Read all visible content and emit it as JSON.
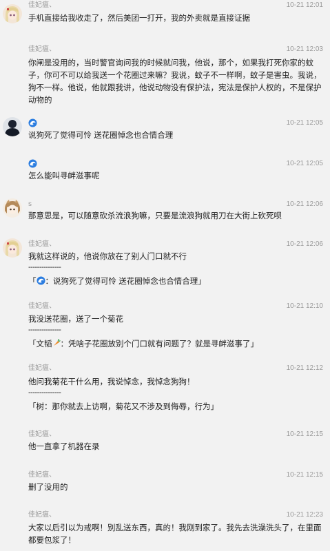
{
  "messages": [
    {
      "sender": "佳妃瘟、",
      "time": "10-21 12:01",
      "text": "手机直接给我收走了，然后美团一打开，我的外卖就是直接证据"
    },
    {
      "sender": "佳妃瘟、",
      "time": "10-21 12:03",
      "text": "你闸是没用的，当时警官询问我的时候就问我，他说，那个，如果我打死你家的蚊子，你可不可以给我送一个花圈过来嘛？我说，蚊子不一样啊，蚊子是害虫。我说，狗不一样。他说，他就跟我讲，他说动物没有保护法，宪法是保护人权的，不是保护动物的"
    },
    {
      "sender": "",
      "time": "10-21 12:05",
      "text": "说狗死了觉得可怜 送花圈悼念也合情合理"
    },
    {
      "sender": "",
      "time": "10-21 12:05",
      "text": "怎么能叫寻衅滋事呢"
    },
    {
      "sender": "s",
      "time": "10-21 12:06",
      "text": "那意思是，可以随意砍杀流浪狗嘛，只要是流浪狗就用刀在大街上砍死呗"
    },
    {
      "sender": "佳妃瘟、",
      "time": "10-21 12:06",
      "text": "我就这样说的，他说你放在了别人门口就不行",
      "separator": "---------------",
      "quote_prefix": "「",
      "quote_text": "：说狗死了觉得可怜 送花圈悼念也合情合理」"
    },
    {
      "sender": "佳妃瘟、",
      "time": "10-21 12:10",
      "text": "我没送花圈，送了一个菊花",
      "separator": "---------------",
      "quote_prefix": "「文韬",
      "quote_text": "：凭啥子花圈放别个门口就有问题了？就是寻衅滋事了」"
    },
    {
      "sender": "佳妃瘟、",
      "time": "10-21 12:12",
      "text": "他问我菊花干什么用，我说悼念，我悼念狗狗！",
      "separator": "---------------",
      "quote_prefix": "「树",
      "quote_text": "：那你就去上访啊，菊花又不涉及到侮辱，行为」"
    },
    {
      "sender": "佳妃瘟、",
      "time": "10-21 12:15",
      "text": "他一直拿了机器在录"
    },
    {
      "sender": "佳妃瘟、",
      "time": "10-21 12:15",
      "text": "删了没用的"
    },
    {
      "sender": "佳妃瘟、",
      "time": "10-21 12:23",
      "text": "大家以后引以为戒啊！别乱送东西，真的！我刚到家了。我先去洗澡洗头了，在里面都要包浆了！"
    }
  ],
  "icons": {
    "user_a_avatar": "anime-blonde-avatar",
    "user_b_avatar": "dark-figure-avatar",
    "user_c_avatar": "anime-brown-hair-avatar",
    "wave_badge": "wave-icon",
    "carrot": "carrot-icon"
  },
  "colors": {
    "background": "#f2f2f2",
    "meta_text": "#9a9a9a",
    "body_text": "#1f1f1f",
    "wave_blue": "#2b7de0"
  }
}
